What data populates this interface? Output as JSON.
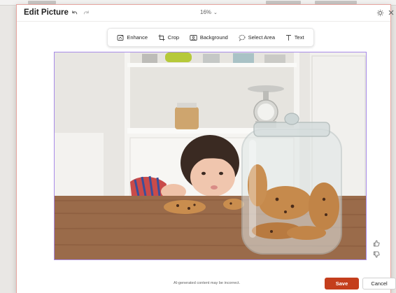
{
  "dialog": {
    "title": "Edit Picture",
    "zoom_level": "16%"
  },
  "toolbar": {
    "items": [
      {
        "label": "Enhance",
        "icon": "enhance-icon"
      },
      {
        "label": "Crop",
        "icon": "crop-icon"
      },
      {
        "label": "Background",
        "icon": "background-icon"
      },
      {
        "label": "Select Area",
        "icon": "select-area-icon"
      },
      {
        "label": "Text",
        "icon": "text-icon"
      }
    ]
  },
  "footer": {
    "disclaimer": "AI-generated content may be incorrect.",
    "save_label": "Save",
    "cancel_label": "Cancel"
  },
  "colors": {
    "accent_save": "#c43e1c",
    "selection_border": "#a88be8",
    "dialog_border": "#e7a6a0"
  },
  "image": {
    "subject": "toddler peeking over a wooden table next to a glass jar of chocolate chip cookies"
  }
}
